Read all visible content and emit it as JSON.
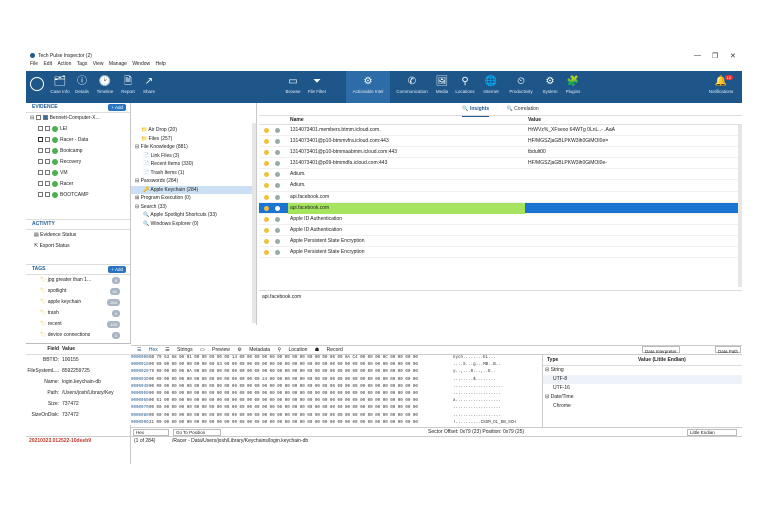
{
  "window": {
    "title": "Tech Pulse Inspector (2)",
    "controls": [
      "—",
      "❐",
      "✕"
    ]
  },
  "menu": [
    "File",
    "Edit",
    "Action",
    "Tags",
    "View",
    "Manage",
    "Window",
    "Help"
  ],
  "ribbon": {
    "left": [
      {
        "icon": "🗂",
        "label": "Case Info"
      },
      {
        "icon": "ⓘ",
        "label": "Details"
      },
      {
        "icon": "🕑",
        "label": "Timeline"
      },
      {
        "icon": "🗎",
        "label": "Report"
      },
      {
        "icon": "↗",
        "label": "Share"
      }
    ],
    "mid": [
      {
        "icon": "▭",
        "label": "Browse"
      },
      {
        "icon": "⏷",
        "label": "File Filter"
      },
      {
        "icon": "⚙",
        "label": "Actionable Intel"
      },
      {
        "icon": "✆",
        "label": "Communication"
      },
      {
        "icon": "🖼",
        "label": "Media"
      },
      {
        "icon": "⚲",
        "label": "Locations"
      },
      {
        "icon": "🌐",
        "label": "Internet"
      },
      {
        "icon": "⏲",
        "label": "Productivity"
      },
      {
        "icon": "⚙",
        "label": "System"
      },
      {
        "icon": "🧩",
        "label": "Plugins"
      }
    ],
    "right": {
      "icon": "🔔",
      "label": "Notifications",
      "badge": "12"
    }
  },
  "evidence": {
    "header": "EVIDENCE",
    "add": "+ Add",
    "root": "Bennett-Computer-X...",
    "items": [
      "LEI",
      "Racer - Data",
      "Bootcamp",
      "Recovery",
      "VM",
      "Racer",
      "BOOTCAMP"
    ]
  },
  "activity": {
    "header": "ACTIVITY",
    "items": [
      "Evidence Status",
      "Export Status"
    ]
  },
  "tags": {
    "header": "TAGS",
    "add": "+ Add",
    "items": [
      {
        "name": "jpg greater than 1...",
        "count": "8"
      },
      {
        "name": "spotlight",
        "count": "61"
      },
      {
        "name": "apple keychain",
        "count": "254"
      },
      {
        "name": "trash",
        "count": "9"
      },
      {
        "name": "recent",
        "count": "100"
      },
      {
        "name": "device connections",
        "count": "2"
      }
    ]
  },
  "props": {
    "headers": [
      "Field",
      "Value"
    ],
    "rows": [
      [
        "BBTID:",
        "100155"
      ],
      [
        "FileSystemL...",
        "8592259725"
      ],
      [
        "Name:",
        "login.keychain-db"
      ],
      [
        "Path:",
        "/Users/josh/Library/Key"
      ],
      [
        "Size:",
        "737472"
      ],
      [
        "SizeOnDisk:",
        "737472"
      ]
    ]
  },
  "tree": [
    {
      "label": "Air Drop (20)",
      "indent": 2,
      "icon": "📁"
    },
    {
      "label": "Files (257)",
      "indent": 2,
      "icon": "📁"
    },
    {
      "label": "File Knowledge (881)",
      "indent": 0,
      "icon": "⊟"
    },
    {
      "label": "Link Files (3)",
      "indent": 2,
      "icon": "📄"
    },
    {
      "label": "Recent Items (330)",
      "indent": 2,
      "icon": "📄"
    },
    {
      "label": "Trash Items (1)",
      "indent": 2,
      "icon": "📄"
    },
    {
      "label": "Passwords (284)",
      "indent": 0,
      "icon": "⊟"
    },
    {
      "label": "Apple Keychain (284)",
      "indent": 2,
      "icon": "🔑",
      "sel": true
    },
    {
      "label": "Program Execution (0)",
      "indent": 0,
      "icon": "⊞"
    },
    {
      "label": "Search (33)",
      "indent": 0,
      "icon": "⊟"
    },
    {
      "label": "Apple Spotlight Shortcuts (33)",
      "indent": 2,
      "icon": "🔍"
    },
    {
      "label": "Windows Explorer (0)",
      "indent": 2,
      "icon": "🔍"
    }
  ],
  "tabs": {
    "insights": "Insights",
    "correlation": "Correlation"
  },
  "grid": {
    "col_name": "Name",
    "col_value": "Value",
    "rows": [
      {
        "name": "1314073401.members.btmm.icloud.com.",
        "value": "HrWVz%_XFseoo 64WTg 0LnL..- .AaA"
      },
      {
        "name": "1314073401@p10-btmmvfra.icloud.com:443",
        "value": "HF/MGSZjaGBLPKW3ih0GiMOI0e="
      },
      {
        "name": "1314073401@p10-btmmaabmm.icloud.com:443",
        "value": "tbdult00"
      },
      {
        "name": "1314073401@p09-btmmdfa.icloud.com:443",
        "value": "HF/MGSZjaGBLPKW3ih0GiMOI0e-"
      },
      {
        "name": "Adium.",
        "value": ""
      },
      {
        "name": "Adium.",
        "value": ""
      },
      {
        "name": "api.facebook.com",
        "value": ""
      },
      {
        "name": "api.facebook.com",
        "value": "",
        "sel": true
      },
      {
        "name": "Apple ID Authentication",
        "value": ""
      },
      {
        "name": "Apple ID Authentication",
        "value": ""
      },
      {
        "name": "Apple Persistent State Encryption",
        "value": ""
      },
      {
        "name": "Apple Persistent State Encryption",
        "value": ""
      }
    ]
  },
  "preview_text": "api.facebook.com",
  "bottom_tabs": [
    "Hex",
    "Strings",
    "Preview",
    "Metadata",
    "Location",
    "Record"
  ],
  "hex": {
    "offsets": [
      "0000000",
      "0000010",
      "0000020",
      "0000030",
      "0000040",
      "0000050",
      "0000060",
      "0000070",
      "0000080",
      "0000090",
      "00000A0"
    ],
    "bytes": [
      "6B 79 63 68 00 01 00 00 00 00 00 14 00 00 00 00 00 00 00 00 00 00 00 00 00 00 0A C4 00 00 00 0C 00 00 00 00",
      "00 00 00 00 00 00 00 00 00 63 00 00 00 00 00 00 00 00 00 00 00 00 00 00 00 00 00 00 00 00 00 00 00 00 00 00",
      "79 00 00 00 00 0A 00 00 00 00 00 00 00 00 00 00 00 00 00 00 00 00 00 00 00 00 00 00 00 00 00 00 00 00 00 00",
      "00 00 00 00 00 00 00 00 00 00 00 00 00 00 00 24 00 00 00 00 00 00 00 00 00 00 00 00 00 00 00 00 00 00 00 00",
      "00 00 00 00 00 00 00 00 00 00 00 00 00 00 00 00 00 00 00 00 00 00 00 00 00 00 00 00 00 00 00 00 00 00 00 00",
      "00 00 00 00 00 00 00 00 00 00 00 00 00 00 00 00 00 00 00 00 00 00 00 00 00 00 00 00 00 00 00 00 00 00 00 00",
      "00 61 00 00 00 00 00 00 00 00 00 00 00 00 00 00 00 00 00 00 00 00 00 00 00 00 00 00 00 00 00 00 00 00 00 00",
      "00 00 00 00 00 00 00 00 00 00 00 00 00 00 00 00 00 00 00 00 00 00 00 00 00 00 00 00 00 00 00 00 00 00 00 00",
      "00 00 00 00 00 00 00 00 00 00 00 00 00 00 00 00 00 00 00 00 00 00 00 00 00 00 00 00 00 00 00 00 00 00 00 00",
      "21 00 00 00 00 00 00 00 00 00 00 00 00 00 00 00 00 00 00 00 00 00 00 00 00 00 00 00 00 00 00 00 00 00 00 00",
      "00 00 00 00 00 00 00 00 00 00 00 00 00 00 00 00 00 00 00 00 00 00 00 00 00 00 00 00 00 00 00 00 00 00 00 00"
    ],
    "ascii": [
      "kych........EL...",
      "....S...g...MB..B..",
      "y..,...0...,..E..",
      "........$........",
      "....................",
      "...................",
      "a..................",
      "...................",
      "...................",
      "!..........CSSM_DL_DB_SCH",
      "EMA_ATTRIBUTES....."
    ]
  },
  "interp": {
    "col_type": "Type",
    "col_value": "Value (Little Endian)",
    "groups": [
      "String",
      "UTF-8",
      "UTF-16",
      "Date/Time",
      "Chrome"
    ],
    "dd1": "Data Interpreter",
    "dd2": "Data Path"
  },
  "status": {
    "format": "Hex",
    "goto": "Go To Position",
    "offset": "Sector Offset: 0x79 (23)  Position: 0x79 (25)",
    "endian": "Little Endian"
  },
  "footer": {
    "id": "20210323.012522-10deeb9",
    "count": "(1 of 284)",
    "path": "/Racer - Data/Users/josh/Library/Keychains/login.keychain-db"
  }
}
